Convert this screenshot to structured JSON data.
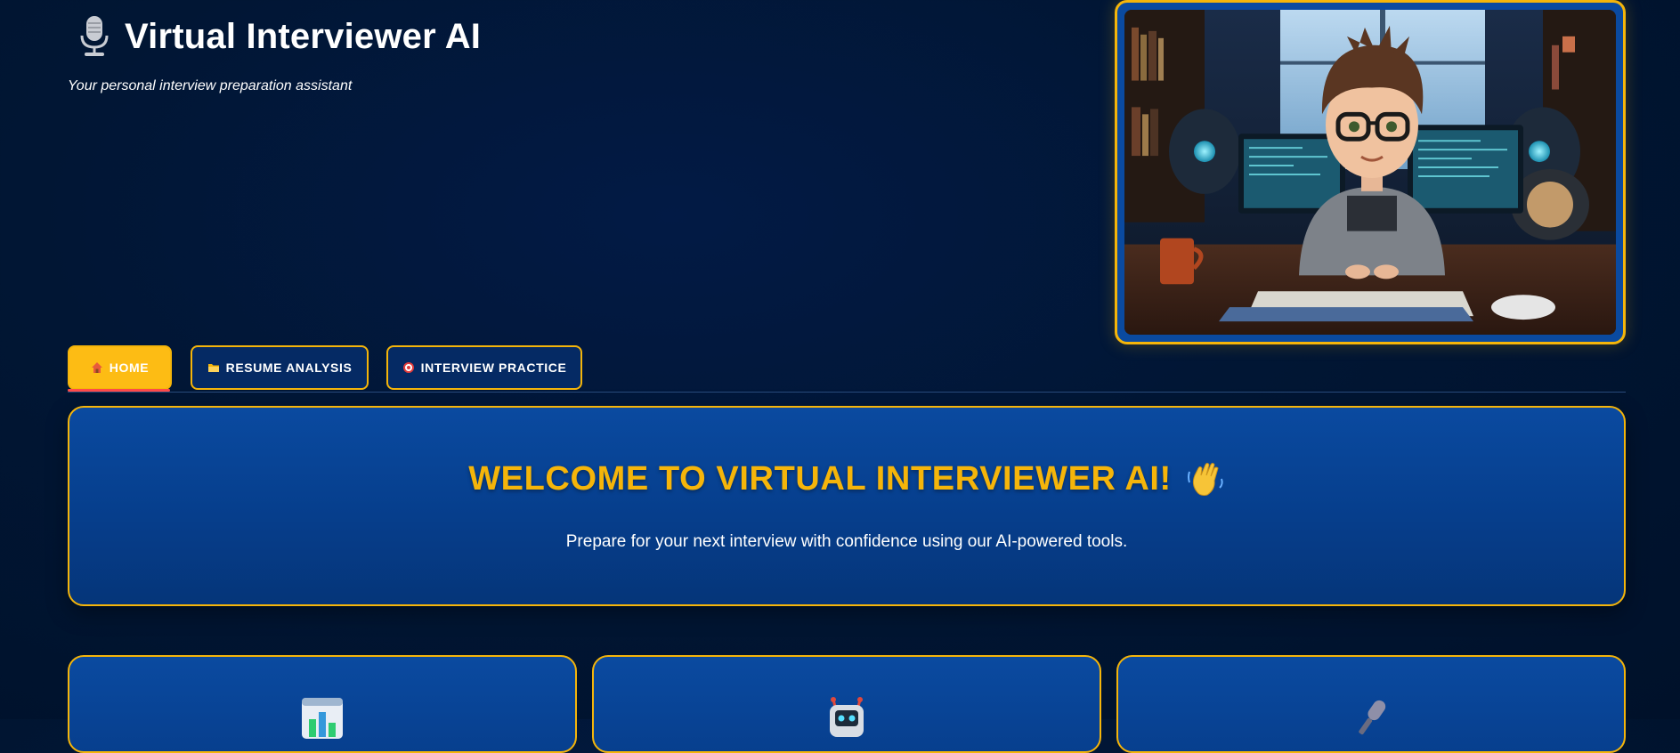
{
  "header": {
    "title": "Virtual Interviewer AI",
    "subtitle": "Your personal interview preparation assistant",
    "title_icon": "microphone-icon"
  },
  "hero": {
    "image_subject": "cartoon developer at computer desk"
  },
  "tabs": [
    {
      "label": "HOME",
      "icon": "house-icon",
      "active": true
    },
    {
      "label": "RESUME ANALYSIS",
      "icon": "folder-icon",
      "active": false
    },
    {
      "label": "INTERVIEW PRACTICE",
      "icon": "target-icon",
      "active": false
    }
  ],
  "welcome": {
    "title": "WELCOME TO VIRTUAL INTERVIEWER AI!",
    "title_icon": "waving-hand-icon",
    "subtitle": "Prepare for your next interview with confidence using our AI-powered tools."
  },
  "features": [
    {
      "icon": "bar-chart-icon"
    },
    {
      "icon": "robot-icon"
    },
    {
      "icon": "microphone-icon"
    }
  ],
  "colors": {
    "background": "#011634",
    "accent": "#f5b50a",
    "card": "#0a4aa0",
    "active_tab_underline": "#ff4b4b"
  }
}
